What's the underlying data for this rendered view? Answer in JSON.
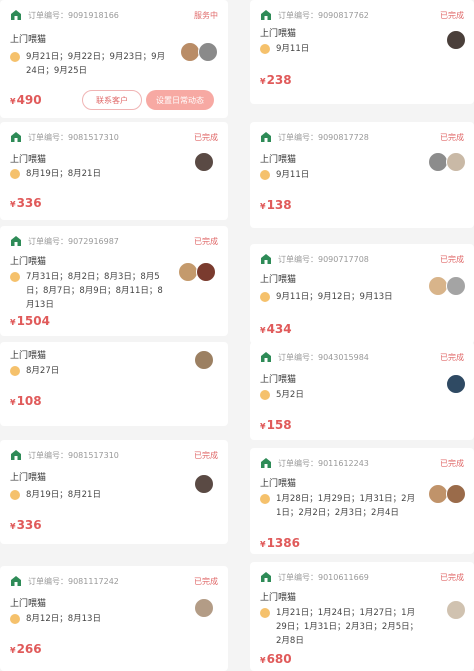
{
  "labels": {
    "order_prefix": "订单编号：",
    "currency": "¥"
  },
  "colors": {
    "accent": "#e05a5a",
    "status": "#e06a6a",
    "clock": "#f5c16c",
    "shop_icon": "#2e8b57"
  },
  "left": [
    {
      "order_no": "9091918166",
      "status": "服务中",
      "service": "上门喂猫",
      "dates": "9月21日；9月22日；9月23日；9月24日；9月25日",
      "price": "490",
      "buttons": {
        "contact": "联系客户",
        "set_status": "设置日常动态"
      },
      "pets": [
        "#b98c66",
        "#8a8a8a"
      ]
    },
    {
      "order_no": "9081517310",
      "status": "已完成",
      "service": "上门喂猫",
      "dates": "8月19日；8月21日",
      "price": "336",
      "pets": [
        "#5a4a44"
      ]
    },
    {
      "order_no": "9072916987",
      "status": "已完成",
      "service": "上门喂猫",
      "dates": "7月31日；8月2日；8月3日；8月5日；8月7日；8月9日；8月11日；8月13日",
      "price": "1504",
      "pets": [
        "#c49a6c",
        "#7a3b2e"
      ]
    },
    {
      "service": "上门喂猫",
      "dates": "8月27日",
      "price": "108",
      "pets": [
        "#9c8062"
      ]
    },
    {
      "order_no": "9081517310",
      "status": "已完成",
      "service": "上门喂猫",
      "dates": "8月19日；8月21日",
      "price": "336",
      "pets": [
        "#5a4a44"
      ]
    },
    {
      "order_no": "9081117242",
      "status": "已完成",
      "service": "上门喂猫",
      "dates": "8月12日；8月13日",
      "price": "266",
      "pets": [
        "#b39c86"
      ]
    }
  ],
  "right": [
    {
      "order_no": "9090817762",
      "status": "已完成",
      "service": "上门喂猫",
      "dates": "9月11日",
      "price": "238",
      "pets": [
        "#4a3f3a"
      ]
    },
    {
      "order_no": "9090817728",
      "status": "已完成",
      "service": "上门喂猫",
      "dates": "9月11日",
      "price": "138",
      "pets": [
        "#8c8c8c",
        "#c9b9a6"
      ]
    },
    {
      "order_no": "9090717708",
      "status": "已完成",
      "service": "上门喂猫",
      "dates": "9月11日；9月12日；9月13日",
      "price": "434",
      "pets": [
        "#d8b48a",
        "#a4a4a4"
      ]
    },
    {
      "order_no": "9043015984",
      "status": "已完成",
      "service": "上门喂猫",
      "dates": "5月2日",
      "price": "158",
      "pets": [
        "#2f4a63"
      ]
    },
    {
      "order_no": "9011612243",
      "status": "已完成",
      "service": "上门喂猫",
      "dates": "1月28日；1月29日；1月31日；2月1日；2月2日；2月3日；2月4日",
      "price": "1386",
      "pets": [
        "#c0936a",
        "#9a6b4a"
      ]
    },
    {
      "order_no": "9010611669",
      "status": "已完成",
      "service": "上门喂猫",
      "dates": "1月21日；1月24日；1月27日；1月29日；1月31日；2月3日；2月5日；2月8日",
      "price": "680",
      "pets": [
        "#d0c2b0"
      ]
    }
  ]
}
